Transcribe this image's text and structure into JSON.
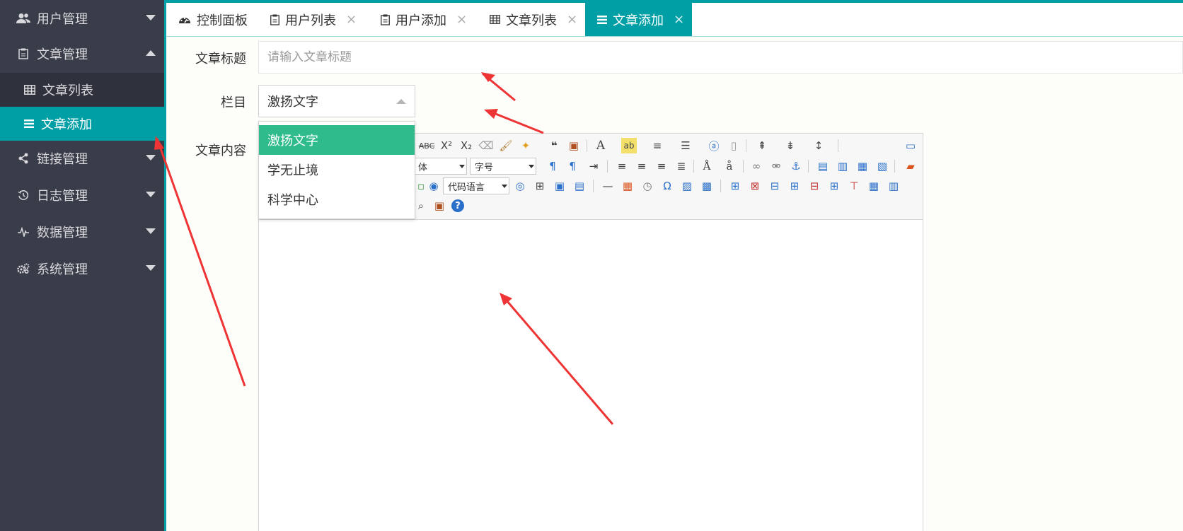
{
  "sidebar": {
    "items": [
      {
        "label": "用户管理",
        "icon": "users-icon",
        "state": "collapsed"
      },
      {
        "label": "文章管理",
        "icon": "clipboard-icon",
        "state": "expanded"
      },
      {
        "label": "链接管理",
        "icon": "share-icon",
        "state": "collapsed"
      },
      {
        "label": "日志管理",
        "icon": "history-icon",
        "state": "collapsed"
      },
      {
        "label": "数据管理",
        "icon": "pulse-icon",
        "state": "collapsed"
      },
      {
        "label": "系统管理",
        "icon": "cogs-icon",
        "state": "collapsed"
      }
    ],
    "sub_items": [
      {
        "label": "文章列表",
        "icon": "table-icon",
        "active": false
      },
      {
        "label": "文章添加",
        "icon": "list-icon",
        "active": true
      }
    ]
  },
  "tabs": [
    {
      "label": "控制面板",
      "icon": "dashboard-icon",
      "closable": false,
      "active": false
    },
    {
      "label": "用户列表",
      "icon": "clipboard-icon",
      "closable": true,
      "active": false
    },
    {
      "label": "用户添加",
      "icon": "clipboard-icon",
      "closable": true,
      "active": false
    },
    {
      "label": "文章列表",
      "icon": "table-icon",
      "closable": true,
      "active": false
    },
    {
      "label": "文章添加",
      "icon": "list-icon",
      "closable": true,
      "active": true
    }
  ],
  "close_glyph": "×",
  "form": {
    "title_label": "文章标题",
    "title_placeholder": "请输入文章标题",
    "category_label": "栏目",
    "category_value": "激扬文字",
    "category_options": [
      "激扬文字",
      "学无止境",
      "科学中心"
    ],
    "content_label": "文章内容"
  },
  "editor": {
    "font_family_select": "体",
    "font_size_select": "字号",
    "code_lang_select": "代码语言"
  },
  "colors": {
    "accent": "#009fa6",
    "sidebar_bg": "#393d49",
    "option_selected": "#2fbb8c",
    "annotation_arrow": "#ee3434"
  }
}
